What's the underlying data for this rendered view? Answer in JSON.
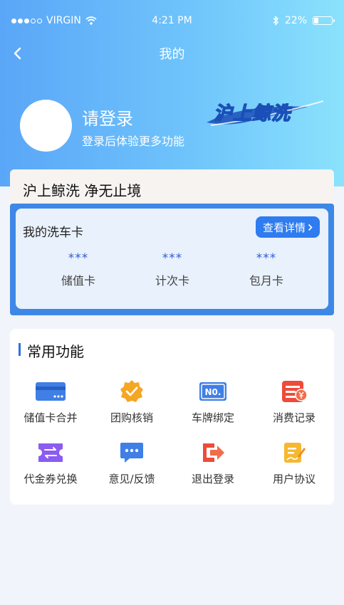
{
  "status_bar": {
    "carrier": "VIRGIN",
    "time": "4:21 PM",
    "battery_text": "22%",
    "battery_level": 0.22
  },
  "nav": {
    "title": "我的"
  },
  "profile": {
    "login_title": "请登录",
    "login_subtitle": "登录后体验更多功能",
    "brand_logo_text": "沪上鲸洗"
  },
  "card": {
    "slogan": "沪上鲸洗 净无止境",
    "title": "我的洗车卡",
    "detail_button": "查看详情",
    "stats": [
      {
        "value": "***",
        "label": "储值卡"
      },
      {
        "value": "***",
        "label": "计次卡"
      },
      {
        "value": "***",
        "label": "包月卡"
      }
    ]
  },
  "functions": {
    "title": "常用功能",
    "items": [
      {
        "label": "储值卡合并",
        "icon": "card-merge-icon"
      },
      {
        "label": "团购核销",
        "icon": "group-buy-check-icon"
      },
      {
        "label": "车牌绑定",
        "icon": "license-plate-icon",
        "icon_text": "N0."
      },
      {
        "label": "消费记录",
        "icon": "consumption-record-icon"
      },
      {
        "label": "代金券兑换",
        "icon": "voucher-exchange-icon"
      },
      {
        "label": "意见/反馈",
        "icon": "feedback-icon"
      },
      {
        "label": "退出登录",
        "icon": "logout-icon"
      },
      {
        "label": "用户协议",
        "icon": "user-agreement-icon"
      }
    ]
  },
  "colors": {
    "primary": "#2e7cf0",
    "card_blue": "#3d88e6",
    "orange": "#f5a623",
    "red": "#ef4b3a",
    "purple": "#8b5cf0"
  }
}
